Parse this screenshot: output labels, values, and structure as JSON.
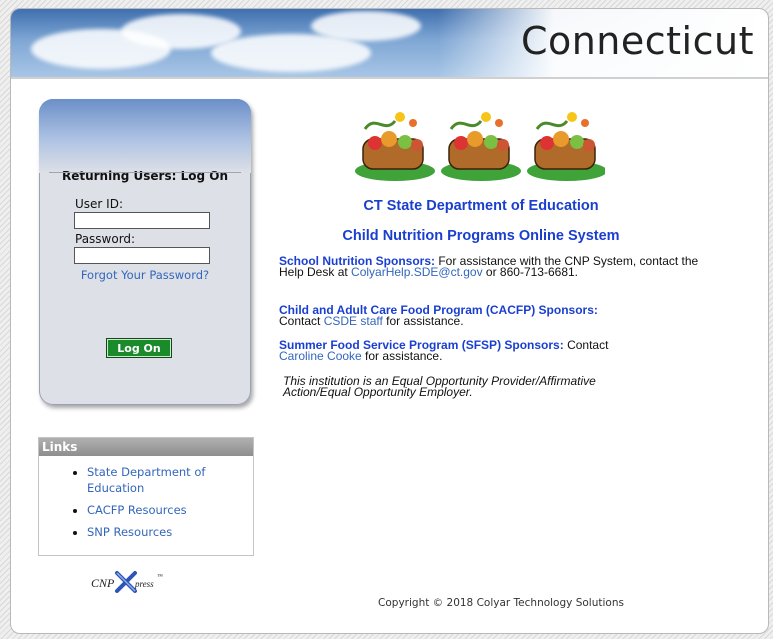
{
  "banner": {
    "title": "Connecticut"
  },
  "login": {
    "heading": "Returning Users: Log On",
    "userid_label": "User ID:",
    "userid_value": "",
    "password_label": "Password:",
    "password_value": "",
    "forgot_label": "Forgot Your Password?",
    "logon_label": "Log On"
  },
  "links": {
    "heading": "Links",
    "items": [
      {
        "label": "State Department of Education"
      },
      {
        "label": "CACFP Resources"
      },
      {
        "label": "SNP Resources"
      }
    ]
  },
  "logo": {
    "text": "CNP",
    "text2": "press",
    "tm": "™"
  },
  "main": {
    "title1": "CT State Department of Education",
    "title2": "Child Nutrition Programs Online System",
    "snp_heading": "School Nutrition Sponsors:",
    "snp_text1": " For assistance with the CNP System, contact the Help Desk at ",
    "snp_email": "ColyarHelp.SDE@ct.gov",
    "snp_text2": " or 860-713-6681.",
    "cacfp_heading": "Child and Adult Care Food Program (CACFP) Sponsors:",
    "cacfp_text1": "Contact ",
    "cacfp_link": "CSDE staff",
    "cacfp_text2": " for assistance.",
    "sfsp_heading": "Summer Food Service Program (SFSP) Sponsors:",
    "sfsp_text1": " Contact ",
    "sfsp_link": "Caroline Cooke",
    "sfsp_text2": " for assistance.",
    "eeo": "This institution is an Equal Opportunity Provider/Affirmative Action/Equal Opportunity Employer."
  },
  "footer": {
    "copyright": "Copyright © 2018 Colyar Technology Solutions"
  },
  "colors": {
    "title_blue": "#1a3fd0",
    "link_blue": "#3366bb",
    "button_green": "#1a8a2a"
  }
}
